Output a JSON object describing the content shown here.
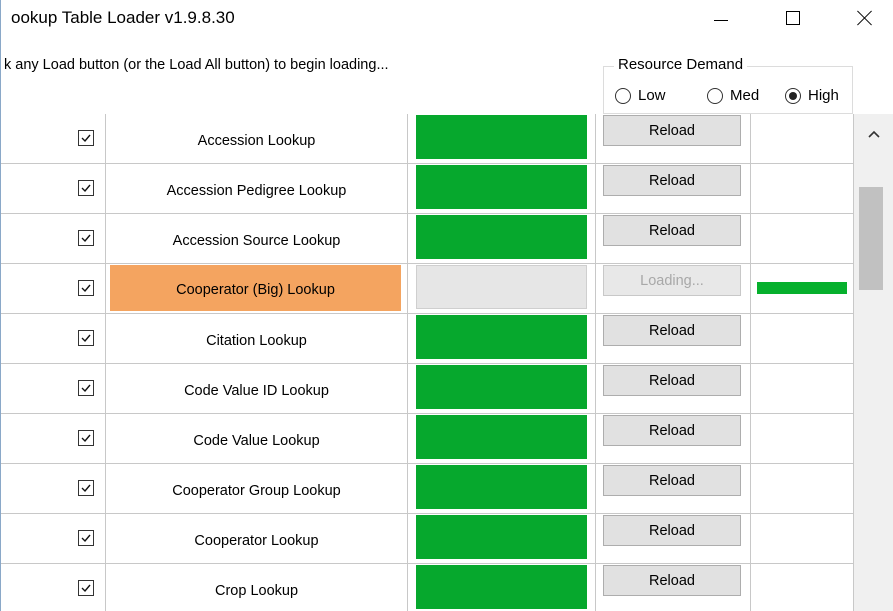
{
  "window": {
    "title": "ookup Table Loader v1.9.8.30",
    "controls": [
      "minimize",
      "maximize",
      "close"
    ]
  },
  "instruction": "k any Load button (or the Load All button) to begin loading...",
  "resource_demand": {
    "label": "Resource Demand",
    "options": [
      "Low",
      "Med",
      "High"
    ],
    "selected": "High"
  },
  "colors": {
    "loaded_bar": "#06a82d",
    "active_row": "#f4a460",
    "progress": "#06b02d"
  },
  "rows": [
    {
      "checked": true,
      "name": "Accession Lookup",
      "button": "Reload",
      "status": "loaded"
    },
    {
      "checked": true,
      "name": "Accession Pedigree Lookup",
      "button": "Reload",
      "status": "loaded"
    },
    {
      "checked": true,
      "name": "Accession Source Lookup",
      "button": "Reload",
      "status": "loaded"
    },
    {
      "checked": true,
      "name": "Cooperator (Big) Lookup",
      "button": "Loading...",
      "status": "loading"
    },
    {
      "checked": true,
      "name": "Citation Lookup",
      "button": "Reload",
      "status": "loaded"
    },
    {
      "checked": true,
      "name": "Code Value ID Lookup",
      "button": "Reload",
      "status": "loaded"
    },
    {
      "checked": true,
      "name": "Code Value Lookup",
      "button": "Reload",
      "status": "loaded"
    },
    {
      "checked": true,
      "name": "Cooperator Group Lookup",
      "button": "Reload",
      "status": "loaded"
    },
    {
      "checked": true,
      "name": "Cooperator Lookup",
      "button": "Reload",
      "status": "loaded"
    },
    {
      "checked": true,
      "name": "Crop Lookup",
      "button": "Reload",
      "status": "loaded"
    }
  ]
}
